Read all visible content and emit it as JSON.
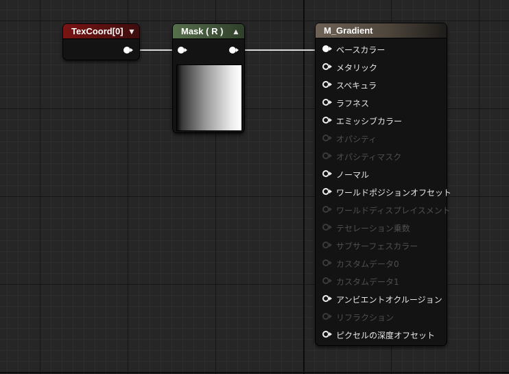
{
  "nodes": {
    "texcoord": {
      "title": "TexCoord[0]",
      "collapse_glyph": "▼",
      "header_color": "#7a1414"
    },
    "mask": {
      "title": "Mask ( R )",
      "collapse_glyph": "▲",
      "header_color": "#566f4c",
      "preview_icon": "gradient-preview"
    },
    "material": {
      "title": "M_Gradient",
      "header_color": "#6d6255",
      "inputs": [
        {
          "label": "ベースカラー",
          "state": "connected"
        },
        {
          "label": "メタリック",
          "state": "enabled"
        },
        {
          "label": "スペキュラ",
          "state": "enabled"
        },
        {
          "label": "ラフネス",
          "state": "enabled"
        },
        {
          "label": "エミッシブカラー",
          "state": "enabled"
        },
        {
          "label": "オパシティ",
          "state": "disabled"
        },
        {
          "label": "オパシティマスク",
          "state": "disabled"
        },
        {
          "label": "ノーマル",
          "state": "enabled"
        },
        {
          "label": "ワールドポジションオフセット",
          "state": "enabled"
        },
        {
          "label": "ワールドディスプレイスメント",
          "state": "disabled"
        },
        {
          "label": "テセレーション乗数",
          "state": "disabled"
        },
        {
          "label": "サブサーフェスカラー",
          "state": "disabled"
        },
        {
          "label": "カスタムデータ0",
          "state": "disabled"
        },
        {
          "label": "カスタムデータ1",
          "state": "disabled"
        },
        {
          "label": "アンビエントオクルージョン",
          "state": "enabled"
        },
        {
          "label": "リフラクション",
          "state": "disabled"
        },
        {
          "label": "ピクセルの深度オフセット",
          "state": "enabled"
        }
      ]
    }
  },
  "colors": {
    "canvas_bg": "#262626",
    "node_body": "#121312",
    "wire": "#dcdcdc",
    "disabled_label": "#4f4f4f"
  }
}
